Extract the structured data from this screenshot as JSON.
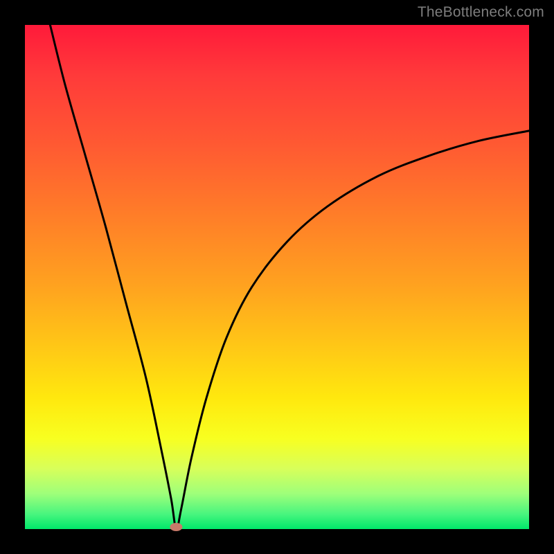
{
  "watermark": "TheBottleneck.com",
  "chart_data": {
    "type": "line",
    "title": "",
    "xlabel": "",
    "ylabel": "",
    "xlim": [
      0,
      100
    ],
    "ylim": [
      0,
      100
    ],
    "grid": false,
    "legend": false,
    "series": [
      {
        "name": "bottleneck-curve",
        "x": [
          5,
          8,
          12,
          16,
          20,
          24,
          27,
          29,
          30,
          31,
          33,
          36,
          40,
          45,
          52,
          60,
          70,
          80,
          90,
          100
        ],
        "y": [
          100,
          88,
          74,
          60,
          45,
          30,
          16,
          6,
          0,
          4,
          14,
          26,
          38,
          48,
          57,
          64,
          70,
          74,
          77,
          79
        ]
      }
    ],
    "marker": {
      "x": 30,
      "y": 0,
      "color": "#c97a6a"
    }
  }
}
